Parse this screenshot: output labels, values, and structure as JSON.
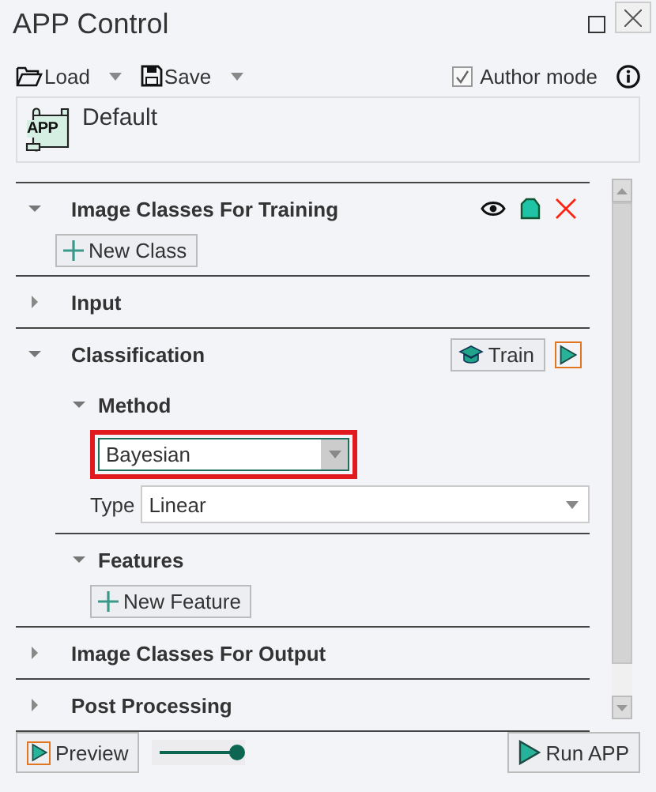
{
  "window": {
    "title": "APP Control"
  },
  "toolbar": {
    "load": "Load",
    "save": "Save",
    "author_mode": {
      "label": "Author mode",
      "checked": true
    }
  },
  "profile": {
    "icon_text": "APP",
    "name": "Default"
  },
  "sections": [
    {
      "title": "Image Classes For Training",
      "expanded": true,
      "kind": "classes",
      "button": "New Class"
    },
    {
      "title": "Input",
      "expanded": false,
      "kind": "plain"
    },
    {
      "title": "Classification",
      "expanded": true,
      "kind": "classification",
      "action": "Train",
      "subsections": [
        {
          "title": "Method",
          "expanded": true,
          "kind": "method",
          "method": {
            "value": "Bayesian",
            "highlighted": true
          },
          "type": {
            "label": "Type",
            "value": "Linear"
          }
        },
        {
          "title": "Features",
          "expanded": true,
          "kind": "features",
          "button": "New Feature"
        }
      ]
    },
    {
      "title": "Image Classes For Output",
      "expanded": false,
      "kind": "plain"
    },
    {
      "title": "Post Processing",
      "expanded": false,
      "kind": "plain"
    }
  ],
  "footer": {
    "preview": "Preview",
    "slider": {
      "level": 1
    },
    "run": "Run APP"
  }
}
